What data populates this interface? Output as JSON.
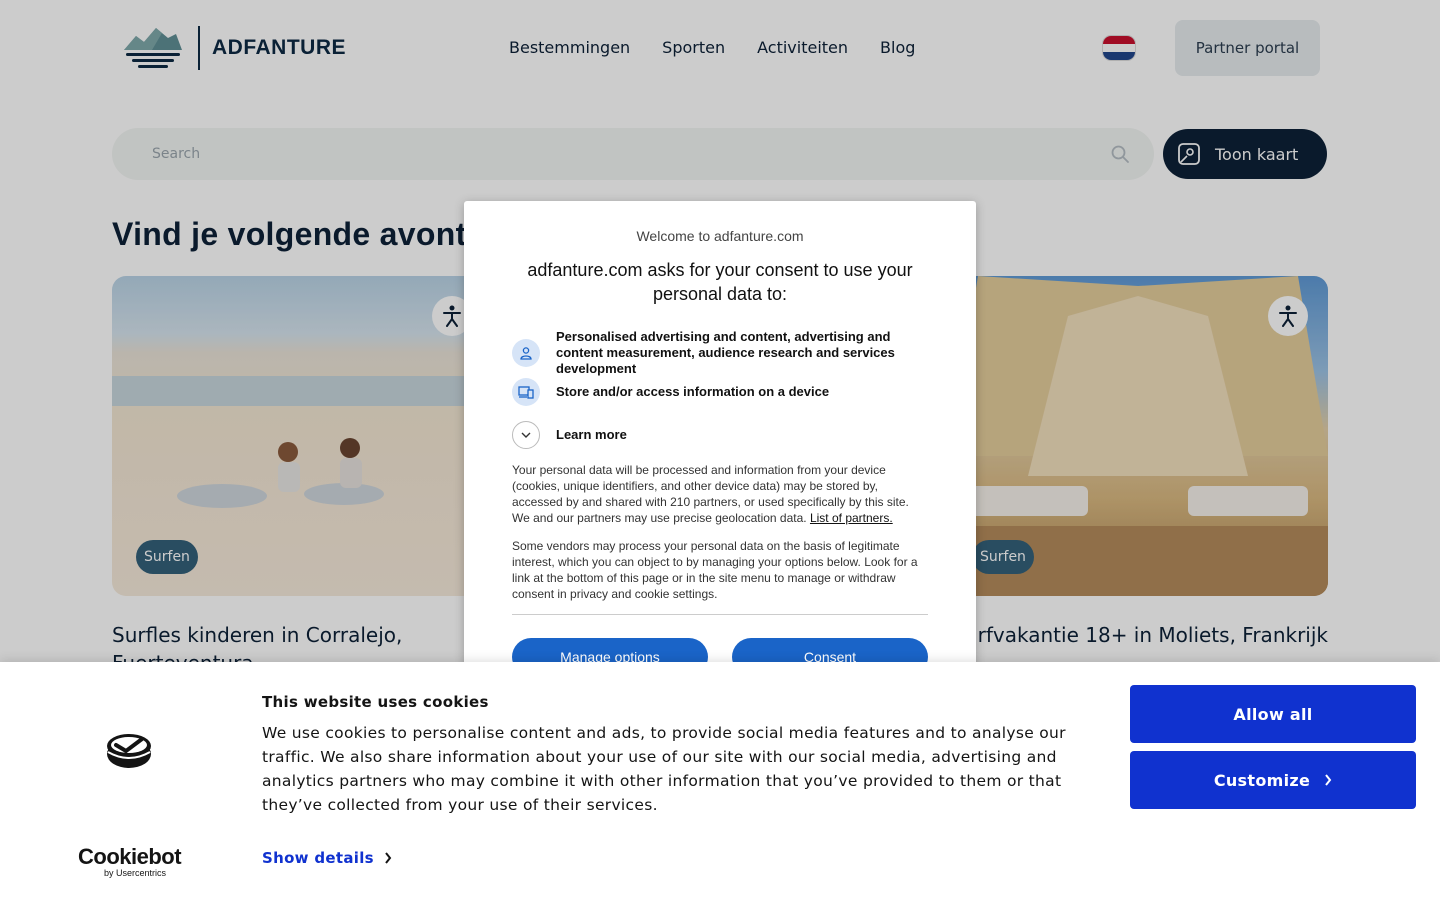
{
  "header": {
    "logo_text": "ADFANTURE",
    "nav": [
      "Bestemmingen",
      "Sporten",
      "Activiteiten",
      "Blog"
    ],
    "partner_label": "Partner portal"
  },
  "search": {
    "placeholder": "Search",
    "map_button": "Toon kaart"
  },
  "main": {
    "headline": "Vind je volgende avontuur",
    "cards": [
      {
        "badge": "Surfen",
        "title": "Surfles kinderen in Corralejo, Fuerteventura"
      },
      {
        "badge": "Surfen",
        "title": "Surfvakantie 18+ in Moliets, Frankrijk"
      }
    ]
  },
  "consent_modal": {
    "welcome": "Welcome to adfanture.com",
    "heading": "adfanture.com asks for your consent to use your personal data to:",
    "purposes": [
      "Personalised advertising and content, advertising and content measurement, audience research and services development",
      "Store and/or access information on a device",
      "Learn more"
    ],
    "paragraph1": "Your personal data will be processed and information from your device (cookies, unique identifiers, and other device data) may be stored by, accessed by and shared with 210 partners, or used specifically by this site. We and our partners may use precise geolocation data.",
    "partners_link": "List of partners.",
    "paragraph2": "Some vendors may process your personal data on the basis of legitimate interest, which you can object to by managing your options below. Look for a link at the bottom of this page or in the site menu to manage or withdraw consent in privacy and cookie settings.",
    "manage_button": "Manage options",
    "consent_button": "Consent"
  },
  "cookie_banner": {
    "brand": "Cookiebot",
    "brand_sub": "by Usercentrics",
    "title": "This website uses cookies",
    "body": "We use cookies to personalise content and ads, to provide social media features and to analyse our traffic. We also share information about your use of our site with our social media, advertising and analytics partners who may combine it with other information that you’ve provided to them or that they’ve collected from your use of their services.",
    "details_link": "Show details",
    "allow_all": "Allow all",
    "customize": "Customize"
  },
  "colors": {
    "navy": "#0d2137",
    "cookiebot_blue": "#1032cf",
    "consent_blue": "#1a64c8",
    "badge": "#34617a"
  }
}
